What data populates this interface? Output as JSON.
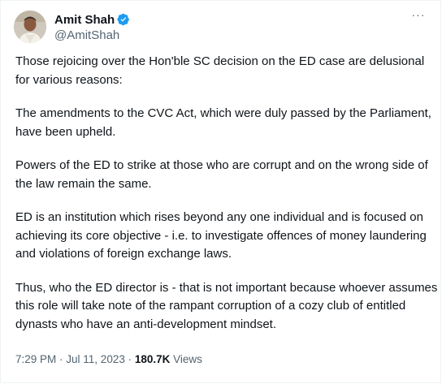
{
  "author": {
    "display_name": "Amit Shah",
    "handle": "@AmitShah",
    "verified_icon": "verified-badge-icon",
    "verified_color": "#1d9bf0"
  },
  "menu": {
    "more_icon": "more-options-icon",
    "more_glyph": "···"
  },
  "tweet": {
    "paragraphs": [
      "Those rejoicing over the Hon'ble SC decision on the ED case are delusional for various reasons:",
      "The amendments to the CVC Act, which were duly passed by the Parliament, have been upheld.",
      "Powers of the ED to strike at those who are corrupt and on the wrong side of the law remain the same.",
      "ED is an institution which rises beyond any one individual and is focused on achieving its core objective - i.e. to investigate offences of money laundering and violations of foreign exchange laws.",
      "Thus, who the ED director is - that is not important because whoever assumes this role will take note of the rampant corruption of a cozy club of entitled dynasts who have an anti-development mindset."
    ]
  },
  "meta": {
    "time": "7:29 PM",
    "separator": " · ",
    "date": "Jul 11, 2023",
    "views_count": "180.7K",
    "views_label": " Views"
  },
  "colors": {
    "text_primary": "#0f1419",
    "text_secondary": "#536471",
    "accent": "#1d9bf0"
  }
}
